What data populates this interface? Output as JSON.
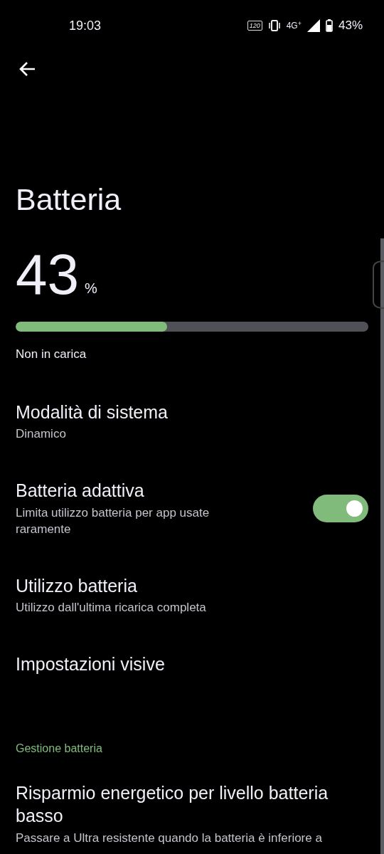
{
  "status_bar": {
    "time": "19:03",
    "refresh_badge": "120",
    "network": "4G$^{+}$",
    "battery": "43%"
  },
  "title": "Batteria",
  "battery": {
    "percent": "43",
    "unit": "%",
    "level": 0.43,
    "status": "Non in carica"
  },
  "items": [
    {
      "kind": "text",
      "title": "Modalità di sistema",
      "subtitle": "Dinamico"
    },
    {
      "kind": "switch",
      "title": "Batteria adattiva",
      "subtitle": "Limita utilizzo batteria per app usate raramente",
      "on": true
    },
    {
      "kind": "text",
      "title": "Utilizzo batteria",
      "subtitle": "Utilizzo dall'ultima ricarica completa"
    },
    {
      "kind": "text",
      "title": "Impostazioni visive"
    }
  ],
  "section": {
    "title": "Gestione batteria",
    "items": [
      {
        "kind": "text",
        "title": "Risparmio energetico per livello batteria basso",
        "subtitle": "Passare a Ultra resistente quando la batteria è inferiore a"
      }
    ]
  }
}
